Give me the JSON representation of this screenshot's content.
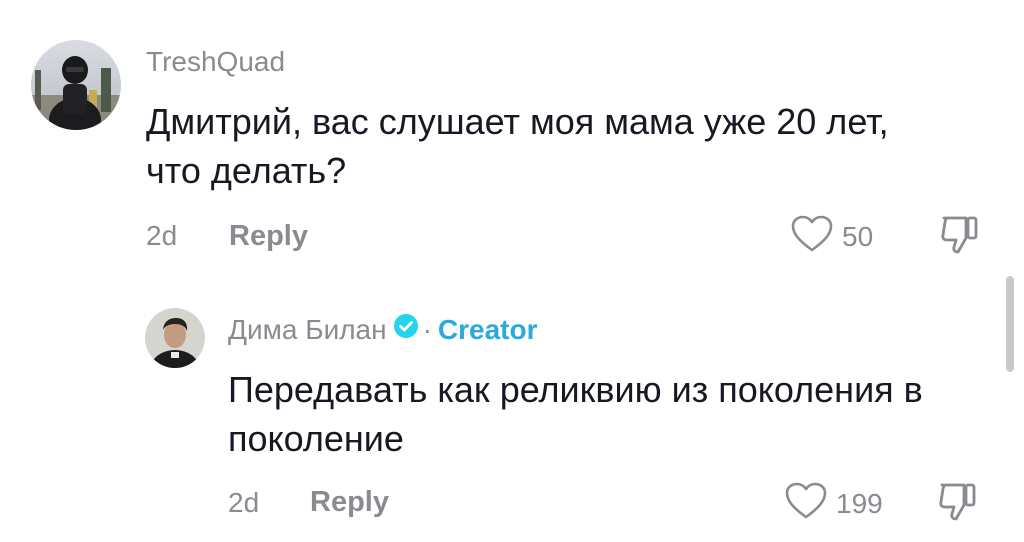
{
  "comment": {
    "username": "TreshQuad",
    "line1": "Дмитрий, вас слушает моя мама уже 20 лет,",
    "line2": "что делать?",
    "time": "2d",
    "reply_label": "Reply",
    "likes": "50"
  },
  "reply": {
    "username": "Дима Билан",
    "separator": "·",
    "badge": "Creator",
    "line1": "Передавать как реликвию из поколения в",
    "line2": "поколение",
    "time": "2d",
    "reply_label": "Reply",
    "likes": "199"
  },
  "colors": {
    "text": "#161823",
    "muted": "#8a8b91",
    "creator": "#2aa9dc",
    "verified": "#20d5ec"
  },
  "icons": {
    "like": "heart-outline-icon",
    "dislike": "thumbs-down-outline-icon",
    "verified": "verified-check-icon"
  }
}
